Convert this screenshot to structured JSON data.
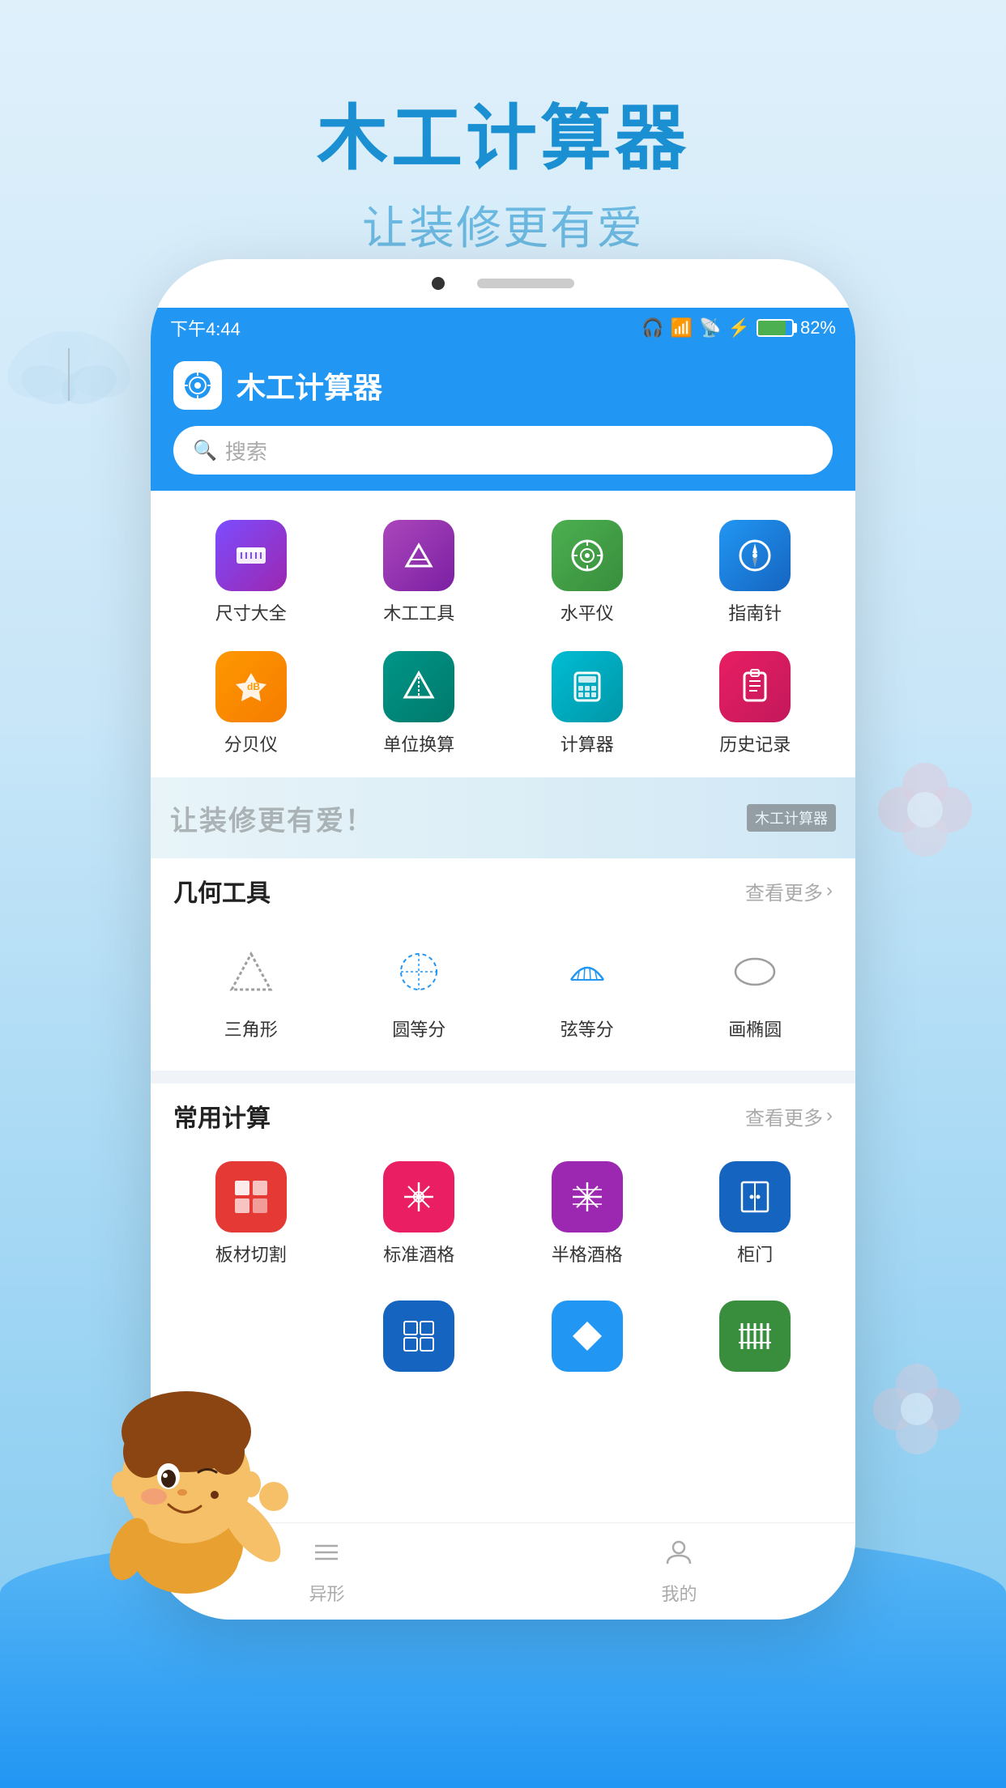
{
  "app": {
    "main_title": "木工计算器",
    "sub_title": "让装修更有爱",
    "header_title": "木工计算器"
  },
  "status_bar": {
    "time": "下午4:44",
    "battery_pct": "82%"
  },
  "search": {
    "placeholder": "搜索"
  },
  "top_tools": [
    {
      "label": "尺寸大全",
      "color": "ic-purple",
      "icon": "📏"
    },
    {
      "label": "木工工具",
      "color": "ic-purple2",
      "icon": "🔧"
    },
    {
      "label": "水平仪",
      "color": "ic-green",
      "icon": "🔵"
    },
    {
      "label": "指南针",
      "color": "ic-blue",
      "icon": "🧭"
    },
    {
      "label": "分贝仪",
      "color": "ic-orange",
      "icon": "📢"
    },
    {
      "label": "单位换算",
      "color": "ic-teal",
      "icon": "🔺"
    },
    {
      "label": "计算器",
      "color": "ic-cyan",
      "icon": "🔢"
    },
    {
      "label": "历史记录",
      "color": "ic-pink",
      "icon": "📋"
    }
  ],
  "banner": {
    "text": "让装修更有爱！",
    "tag": "木工计算器"
  },
  "geo_section": {
    "title": "几何工具",
    "more": "查看更多",
    "tools": [
      {
        "label": "三角形",
        "shape": "triangle"
      },
      {
        "label": "圆等分",
        "shape": "circle-dashed"
      },
      {
        "label": "弦等分",
        "shape": "arc"
      },
      {
        "label": "画椭圆",
        "shape": "ellipse"
      }
    ]
  },
  "calc_section": {
    "title": "常用计算",
    "more": "查看更多",
    "tools": [
      {
        "label": "板材切割",
        "color": "#e53935",
        "icon": "▦"
      },
      {
        "label": "标准酒格",
        "color": "#e91e63",
        "icon": "⁑"
      },
      {
        "label": "半格酒格",
        "color": "#9c27b0",
        "icon": "⊠"
      },
      {
        "label": "柜门",
        "color": "#1565c0",
        "icon": "▯"
      }
    ]
  },
  "bottom_row": [
    {
      "label": "",
      "color": "#1565c0",
      "icon": "⊞"
    },
    {
      "label": "",
      "color": "#2196f3",
      "icon": "◆"
    },
    {
      "label": "",
      "color": "#388e3c",
      "icon": "⊞"
    }
  ],
  "tabs": [
    {
      "label": "异形",
      "icon": "≡",
      "active": false
    },
    {
      "label": "我的",
      "icon": "👤",
      "active": false
    }
  ]
}
